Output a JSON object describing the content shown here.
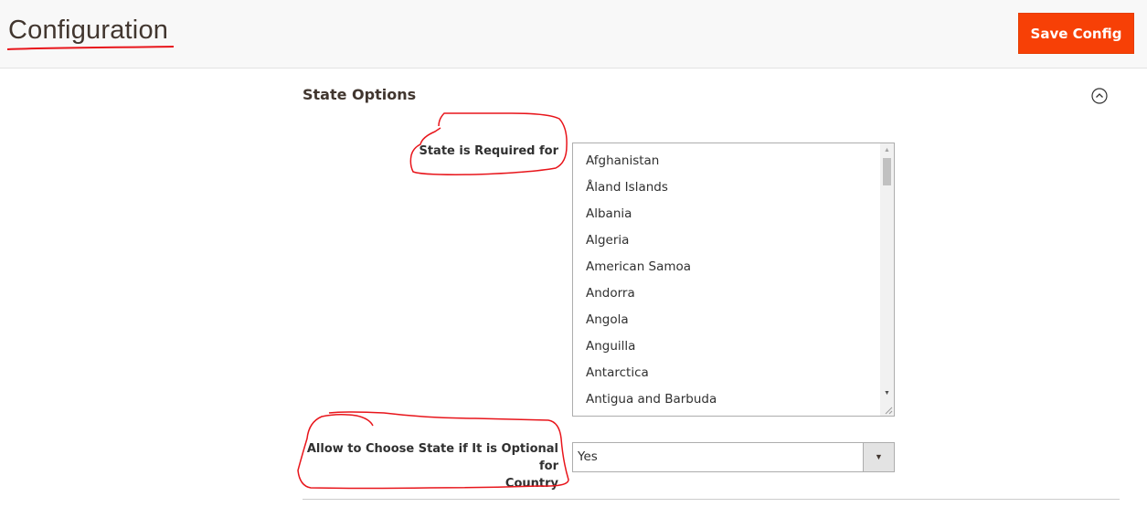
{
  "header": {
    "title": "Configuration",
    "save_button_label": "Save Config"
  },
  "section": {
    "title": "State Options",
    "collapse_icon": "chevron-up-circle-icon"
  },
  "fields": {
    "state_required": {
      "label": "State is Required for",
      "options": [
        "Afghanistan",
        "Åland Islands",
        "Albania",
        "Algeria",
        "American Samoa",
        "Andorra",
        "Angola",
        "Anguilla",
        "Antarctica",
        "Antigua and Barbuda"
      ]
    },
    "allow_optional": {
      "label_line1": "Allow to Choose State if It is Optional for",
      "label_line2": "Country",
      "selected_value": "Yes"
    }
  },
  "colors": {
    "accent": "#f74006",
    "annotation": "#e8151b",
    "header_bg": "#f8f8f8"
  }
}
